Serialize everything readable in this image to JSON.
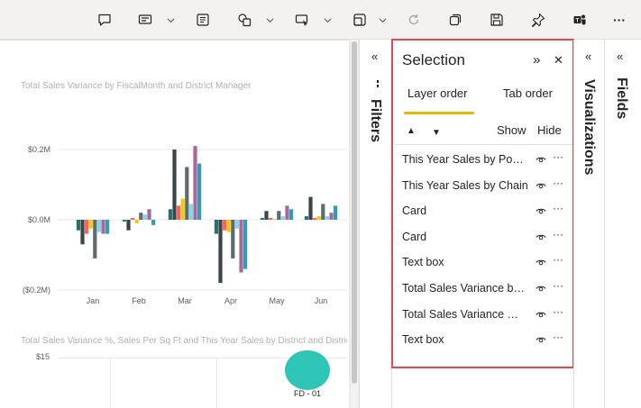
{
  "toolbar": {
    "icons": [
      "comment-icon",
      "smart-narrative-icon",
      "text-box-icon",
      "shapes-icon",
      "buttons-icon",
      "visual-icon",
      "refresh-icon",
      "copy-icon",
      "save-icon",
      "pin-icon",
      "teams-icon",
      "more-icon"
    ],
    "more_label": "···"
  },
  "canvas": {
    "chart1": {
      "chart_data": {
        "type": "bar",
        "title": "Total Sales Variance by FiscalMonth and District Manager",
        "categories": [
          "Jan",
          "Feb",
          "Mar",
          "Apr",
          "May",
          "Jun"
        ],
        "y_ticks": [
          "$0.2M",
          "$0.0M",
          "($0.2M)"
        ],
        "ylim": [
          -0.2,
          0.2
        ],
        "series_colors": [
          "#2f6f6a",
          "#374649",
          "#fd625e",
          "#f2c80f",
          "#5f6b6d",
          "#8ad4eb",
          "#a66999",
          "#3599b8"
        ],
        "series": [
          {
            "values": [
              -0.03,
              -0.005,
              0.03,
              -0.04,
              0.005,
              0.01
            ]
          },
          {
            "values": [
              -0.07,
              -0.03,
              0.2,
              -0.18,
              0.025,
              0.065
            ]
          },
          {
            "values": [
              -0.04,
              0.005,
              0.04,
              -0.03,
              0.005,
              0.005
            ]
          },
          {
            "values": [
              -0.025,
              -0.01,
              0.06,
              -0.035,
              0.002,
              0.01
            ]
          },
          {
            "values": [
              -0.11,
              0.02,
              0.15,
              -0.11,
              0.025,
              0.045
            ]
          },
          {
            "values": [
              -0.035,
              0.015,
              0.045,
              -0.025,
              0.01,
              0.01
            ]
          },
          {
            "values": [
              -0.04,
              0.03,
              0.21,
              -0.15,
              0.04,
              0.02
            ]
          },
          {
            "values": [
              -0.04,
              -0.015,
              0.16,
              -0.14,
              0.03,
              0.04
            ]
          }
        ],
        "grid": true
      }
    },
    "chart2": {
      "title": "Total Sales Variance %, Sales Per Sq Ft and This Year Sales by District and District",
      "y_tick": "$15",
      "bubble_label": "FD - 01",
      "bubble_color": "#2ec4b6"
    }
  },
  "filters": {
    "title": "Filters",
    "collapse_icon": "«"
  },
  "selection": {
    "title": "Selection",
    "expand_icon": "»",
    "close_icon": "✕",
    "tabs": [
      {
        "label": "Layer order",
        "active": true
      },
      {
        "label": "Tab order",
        "active": false
      }
    ],
    "up_arrow": "▲",
    "down_arrow": "▼",
    "show_label": "Show",
    "hide_label": "Hide",
    "items": [
      {
        "label": "This Year Sales by Postal"
      },
      {
        "label": "This Year Sales by Chain"
      },
      {
        "label": "Card"
      },
      {
        "label": "Card"
      },
      {
        "label": "Text box"
      },
      {
        "label": "Total Sales Variance by FiscalMonth"
      },
      {
        "label": "Total Sales Variance % by Month"
      },
      {
        "label": "Text box"
      }
    ],
    "more_label": "···",
    "accent": "#e6b800",
    "highlight_border": "#e8474c"
  },
  "visualizations": {
    "title": "Visualizations",
    "collapse_icon": "«"
  },
  "fields": {
    "title": "Fields",
    "collapse_icon": "«"
  }
}
